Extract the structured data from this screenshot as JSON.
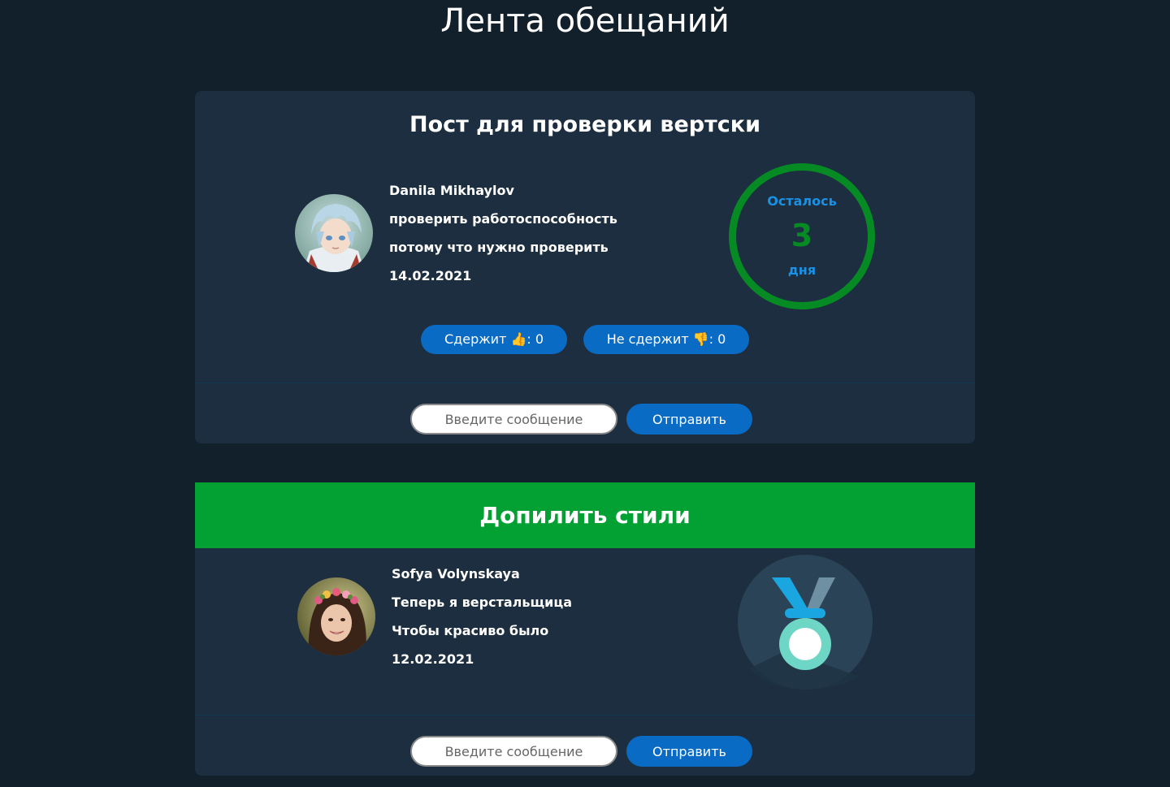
{
  "page": {
    "title": "Лента обещаний"
  },
  "posts": [
    {
      "title": "Пост для проверки вертски",
      "author": "Danila Mikhaylov",
      "promise": "проверить работоспособность",
      "reason": "потому что нужно проверить",
      "date": "14.02.2021",
      "timer": {
        "label": "Осталось",
        "value": "3",
        "unit": "дня"
      },
      "votes": {
        "yes_label": "Сдержит 👍: 0",
        "no_label": "Не сдержит 👎: 0"
      },
      "comment": {
        "placeholder": "Введите сообщение",
        "send_label": "Отправить"
      },
      "status_color": "#1c2e3f"
    },
    {
      "title": "Допилить стили",
      "author": "Sofya Volynskaya",
      "promise": "Теперь я верстальщица",
      "reason": "Чтобы красиво было",
      "date": "12.02.2021",
      "badge_icon": "medal-icon",
      "comment": {
        "placeholder": "Введите сообщение",
        "send_label": "Отправить"
      },
      "status_color": "#03a033"
    }
  ]
}
